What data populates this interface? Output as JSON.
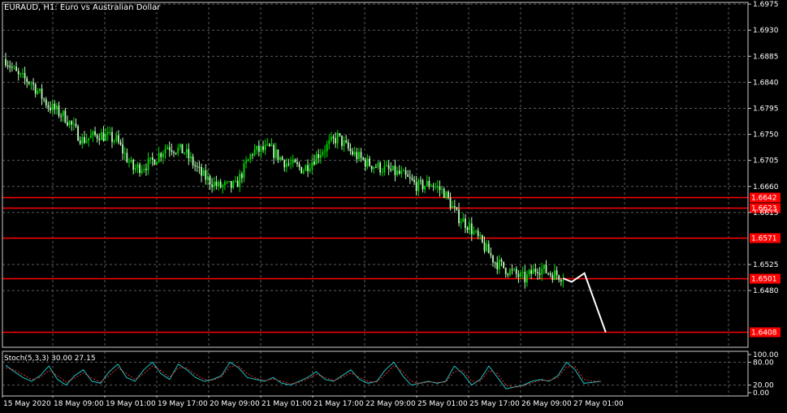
{
  "window": {
    "title": "EURAUD, H1:  Euro vs Australian Dollar"
  },
  "colors": {
    "background": "#000000",
    "grid": "#5a5a5a",
    "frame": "#cccccc",
    "candle_up": "#00e000",
    "candle_down": "#b8ffb8",
    "level_line": "#ff0000",
    "price_tag_bg": "#ff0000",
    "projection": "#ffffff",
    "stoch_main": "#20c0c0",
    "stoch_signal": "#e03030"
  },
  "price_axis": {
    "ticks": [
      "1.6975",
      "1.6930",
      "1.6885",
      "1.6840",
      "1.6795",
      "1.6750",
      "1.6705",
      "1.6660",
      "1.6615",
      "1.6525",
      "1.6480"
    ],
    "ylim": [
      1.6382,
      1.6978
    ]
  },
  "levels": [
    {
      "label": "1.6642",
      "price": 1.6642
    },
    {
      "label": "1.6623",
      "price": 1.6623
    },
    {
      "label": "1.6571",
      "price": 1.6571
    },
    {
      "label": "1.6501",
      "price": 1.6501
    },
    {
      "label": "1.6408",
      "price": 1.6408
    }
  ],
  "time_axis": {
    "labels": [
      "15 May 2020",
      "18 May 09:00",
      "19 May 01:00",
      "19 May 17:00",
      "20 May 09:00",
      "21 May 01:00",
      "21 May 17:00",
      "22 May 09:00",
      "25 May 01:00",
      "25 May 17:00",
      "26 May 09:00",
      "27 May 01:00"
    ]
  },
  "chart_data": [
    {
      "type": "candlestick",
      "title": "EURAUD, H1:  Euro vs Australian Dollar",
      "ylim": [
        1.6382,
        1.6978
      ],
      "key_closes": [
        [
          0,
          1.688
        ],
        [
          6,
          1.685
        ],
        [
          12,
          1.684
        ],
        [
          20,
          1.68
        ],
        [
          28,
          1.678
        ],
        [
          36,
          1.674
        ],
        [
          44,
          1.675
        ],
        [
          52,
          1.674
        ],
        [
          60,
          1.669
        ],
        [
          68,
          1.67
        ],
        [
          76,
          1.673
        ],
        [
          84,
          1.672
        ],
        [
          92,
          1.668
        ],
        [
          100,
          1.666
        ],
        [
          108,
          1.666
        ],
        [
          116,
          1.672
        ],
        [
          124,
          1.6725
        ],
        [
          132,
          1.67
        ],
        [
          140,
          1.669
        ],
        [
          148,
          1.672
        ],
        [
          156,
          1.6745
        ],
        [
          162,
          1.672
        ],
        [
          170,
          1.67
        ],
        [
          178,
          1.669
        ],
        [
          186,
          1.668
        ],
        [
          194,
          1.666
        ],
        [
          200,
          1.6665
        ],
        [
          206,
          1.665
        ],
        [
          212,
          1.661
        ],
        [
          218,
          1.659
        ],
        [
          224,
          1.656
        ],
        [
          230,
          1.653
        ],
        [
          236,
          1.6515
        ],
        [
          244,
          1.65
        ],
        [
          250,
          1.652
        ],
        [
          256,
          1.651
        ],
        [
          262,
          1.6505
        ]
      ],
      "projection": [
        [
          262,
          1.6501
        ],
        [
          266,
          1.6495
        ],
        [
          272,
          1.651
        ],
        [
          282,
          1.6408
        ]
      ]
    },
    {
      "type": "line",
      "title": "Stoch(5,3,3) 30.00 27.15",
      "ylim": [
        0,
        100
      ],
      "ticks": [
        "100.00",
        "80.00",
        "20.00",
        "0.00"
      ],
      "series": [
        {
          "name": "main",
          "values": [
            72,
            55,
            40,
            30,
            45,
            70,
            35,
            20,
            45,
            60,
            30,
            25,
            55,
            75,
            40,
            30,
            60,
            80,
            50,
            35,
            75,
            60,
            40,
            30,
            35,
            45,
            80,
            65,
            40,
            35,
            30,
            40,
            25,
            20,
            30,
            40,
            55,
            35,
            30,
            45,
            60,
            35,
            25,
            30,
            60,
            80,
            45,
            20,
            25,
            30,
            25,
            30,
            70,
            50,
            20,
            35,
            70,
            40,
            10,
            15,
            20,
            30,
            35,
            30,
            45,
            80,
            60,
            25,
            27,
            30
          ]
        },
        {
          "name": "signal",
          "values": [
            65,
            60,
            48,
            35,
            40,
            58,
            45,
            28,
            38,
            52,
            38,
            28,
            45,
            65,
            50,
            35,
            50,
            70,
            58,
            40,
            65,
            65,
            48,
            35,
            33,
            42,
            68,
            70,
            50,
            38,
            32,
            36,
            30,
            23,
            27,
            36,
            48,
            40,
            32,
            40,
            52,
            40,
            30,
            28,
            48,
            72,
            55,
            30,
            24,
            28,
            27,
            28,
            55,
            58,
            30,
            30,
            58,
            50,
            20,
            14,
            18,
            26,
            32,
            32,
            40,
            68,
            68,
            35,
            30,
            30
          ]
        }
      ]
    }
  ]
}
